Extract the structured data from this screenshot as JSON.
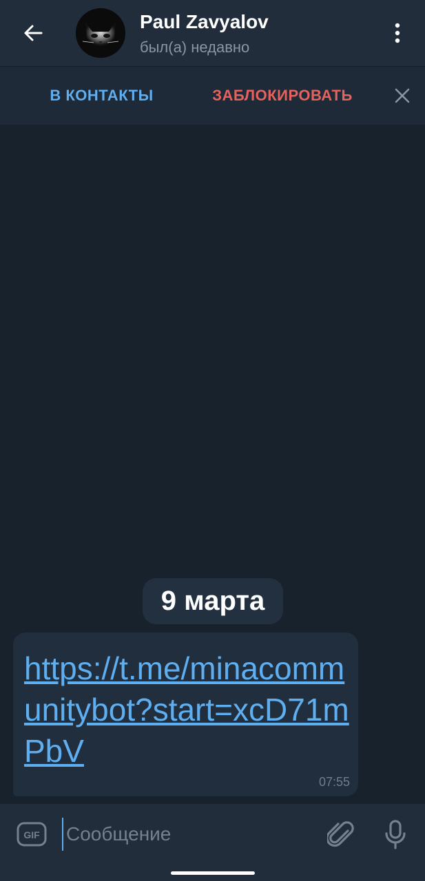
{
  "header": {
    "name": "Paul Zavyalov",
    "status": "был(а) недавно",
    "back_icon": "arrow-left-icon",
    "menu_icon": "more-vertical-icon",
    "avatar_icon": "cat-avatar-icon"
  },
  "action_bar": {
    "add_contact_label": "В КОНТАКТЫ",
    "block_label": "ЗАБЛОКИРОВАТЬ",
    "close_icon": "close-icon",
    "add_contact_color": "#5eaef0",
    "block_color": "#e5625d"
  },
  "chat": {
    "date_label": "9 марта",
    "messages": [
      {
        "text": "https://t.me/minacommunitybot?start=xcD71mPbV",
        "time": "07:55"
      }
    ]
  },
  "composer": {
    "placeholder": "Сообщение",
    "value": "",
    "gif_label": "GIF",
    "attach_icon": "paperclip-icon",
    "mic_icon": "microphone-icon"
  },
  "colors": {
    "background": "#18222d",
    "bar": "#212d3b",
    "bubble": "#212e3d",
    "link": "#5eaef0"
  }
}
